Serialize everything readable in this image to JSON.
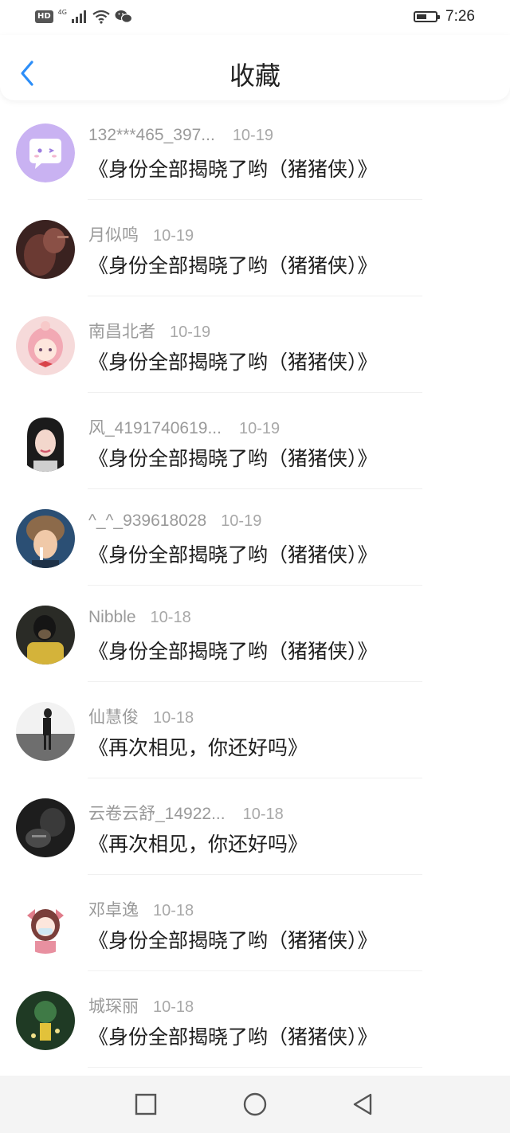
{
  "status_bar": {
    "hd": "HD",
    "network": "4G",
    "time": "7:26",
    "icons": [
      "signal-icon",
      "wifi-icon",
      "wechat-icon",
      "battery-icon"
    ]
  },
  "header": {
    "title": "收藏",
    "back_icon": "chevron-left-icon",
    "accent_color": "#2c8ef8"
  },
  "items": [
    {
      "user": "132***465_397...",
      "date": "10-19",
      "title": "《身份全部揭晓了哟（猪猪侠）》",
      "avatar": "cartoon-chat-avatar"
    },
    {
      "user": "月似鸣",
      "date": "10-19",
      "title": "《身份全部揭晓了哟（猪猪侠）》",
      "avatar": "photo-avatar"
    },
    {
      "user": "南昌北者",
      "date": "10-19",
      "title": "《身份全部揭晓了哟（猪猪侠）》",
      "avatar": "anime-girl-avatar"
    },
    {
      "user": "风_4191740619...",
      "date": "10-19",
      "title": "《身份全部揭晓了哟（猪猪侠）》",
      "avatar": "photo-avatar"
    },
    {
      "user": "^_^_939618028",
      "date": "10-19",
      "title": "《身份全部揭晓了哟（猪猪侠）》",
      "avatar": "photo-avatar"
    },
    {
      "user": "Nibble",
      "date": "10-18",
      "title": "《身份全部揭晓了哟（猪猪侠）》",
      "avatar": "photo-avatar"
    },
    {
      "user": "仙慧俊",
      "date": "10-18",
      "title": "《再次相见，你还好吗》",
      "avatar": "photo-avatar"
    },
    {
      "user": "云卷云舒_14922...",
      "date": "10-18",
      "title": "《再次相见，你还好吗》",
      "avatar": "photo-avatar"
    },
    {
      "user": "邓卓逸",
      "date": "10-18",
      "title": "《身份全部揭晓了哟（猪猪侠）》",
      "avatar": "anime-girl-avatar"
    },
    {
      "user": "城琛丽",
      "date": "10-18",
      "title": "《身份全部揭晓了哟（猪猪侠）》",
      "avatar": "photo-avatar"
    }
  ],
  "nav": {
    "icons": [
      "recent-apps-icon",
      "home-icon",
      "back-icon"
    ]
  }
}
